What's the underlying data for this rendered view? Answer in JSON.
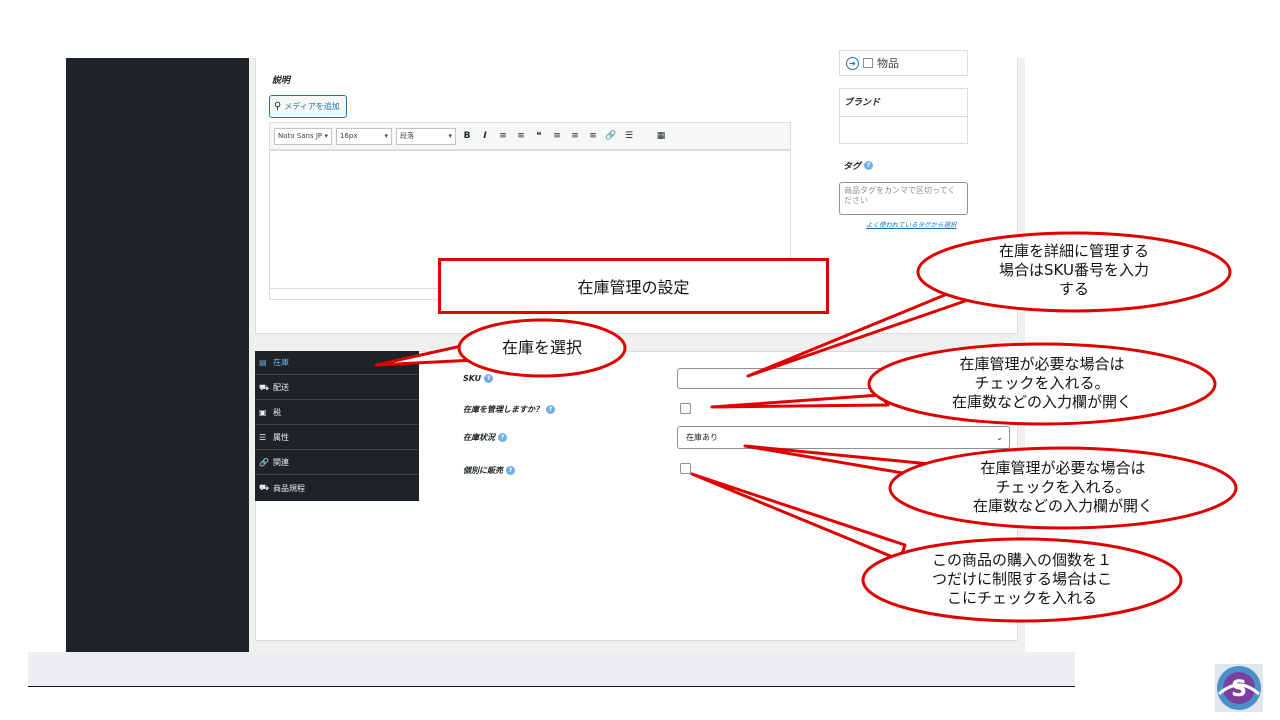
{
  "editor": {
    "description_label": "説明",
    "add_media_label": "メディアを追加",
    "font_family": "Noto Sans JP",
    "font_size": "16px",
    "paragraph": "段落",
    "toolbar_buttons": [
      "B",
      "I",
      "≡",
      "≡",
      "❝",
      "≡",
      "≡",
      "≡",
      "🔗",
      "☰",
      "▦"
    ]
  },
  "sidebar_right": {
    "category_item": "物品",
    "brand_label": "ブランド",
    "tag_label": "タグ",
    "tag_placeholder": "商品タグをカンマで区切ってください",
    "tag_link": "よく使われているタグから選択"
  },
  "product_data": {
    "tabs": [
      {
        "label": "在庫",
        "icon": "inventory-icon",
        "active": true
      },
      {
        "label": "配送",
        "icon": "truck-icon",
        "active": false
      },
      {
        "label": "税",
        "icon": "money-icon",
        "active": false
      },
      {
        "label": "属性",
        "icon": "list-icon",
        "active": false
      },
      {
        "label": "関連",
        "icon": "link-icon",
        "active": false
      },
      {
        "label": "商品規程",
        "icon": "product-rule-icon",
        "active": false
      }
    ],
    "sku_label": "SKU",
    "manage_stock_label": "在庫を管理しますか？",
    "stock_status_label": "在庫状況",
    "stock_status_value": "在庫あり",
    "sold_individually_label": "個別に販売"
  },
  "annotations": {
    "title": "在庫管理の設定",
    "select_stock": "在庫を選択",
    "sku_note": [
      "在庫を詳細に管理する",
      "場合はSKU番号を入力",
      "する"
    ],
    "manage_note": [
      "在庫管理が必要な場合は",
      "チェックを入れる。",
      "在庫数などの入力欄が開く"
    ],
    "status_note": [
      "在庫管理が必要な場合は",
      "チェックを入れる。",
      "在庫数などの入力欄が開く"
    ],
    "individual_note": [
      "この商品の購入の個数を１",
      "つだけに制限する場合はこ",
      "こにチェックを入れる"
    ]
  },
  "colors": {
    "annotation_red": "#e00000",
    "sidebar_dark": "#1d2327",
    "accent_blue": "#2271b1"
  }
}
